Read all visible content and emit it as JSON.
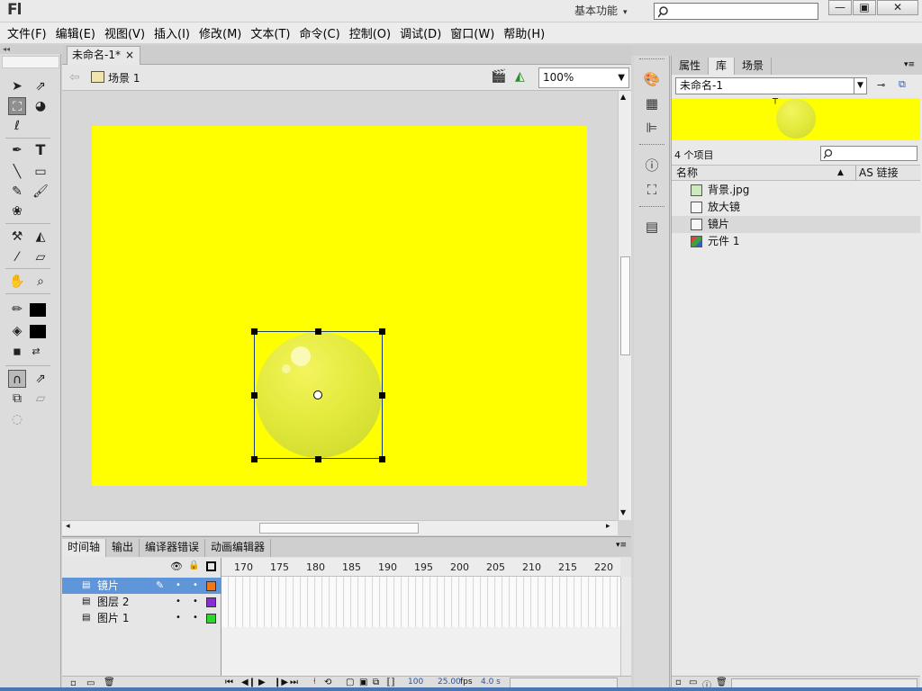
{
  "app": {
    "logo": "Fl",
    "workspace": "基本功能",
    "window_controls": {
      "minimize": "—",
      "maximize": "▣",
      "close": "✕"
    }
  },
  "menu": [
    "文件(F)",
    "编辑(E)",
    "视图(V)",
    "插入(I)",
    "修改(M)",
    "文本(T)",
    "命令(C)",
    "控制(O)",
    "调试(D)",
    "窗口(W)",
    "帮助(H)"
  ],
  "document": {
    "tab_title": "未命名-1*",
    "tab_close": "×",
    "scene": "场景 1",
    "zoom": "100%",
    "stage_color": "#ffff00"
  },
  "timeline": {
    "tabs": [
      "时间轴",
      "输出",
      "编译器错误",
      "动画编辑器"
    ],
    "frame_numbers": [
      "170",
      "175",
      "180",
      "185",
      "190",
      "195",
      "200",
      "205",
      "210",
      "215",
      "220"
    ],
    "layers": [
      {
        "name": "镜片",
        "selected": true,
        "color": "#f07818"
      },
      {
        "name": "图层 2",
        "selected": false,
        "color": "#8a2bd8"
      },
      {
        "name": "图片 1",
        "selected": false,
        "color": "#2ad82a"
      }
    ],
    "status": {
      "frame": "100",
      "fps": "25.00",
      "fps_unit": "fps",
      "time": "4.0 s"
    }
  },
  "library": {
    "tabs": [
      "属性",
      "库",
      "场景"
    ],
    "active_tab": "库",
    "document": "未命名-1",
    "item_count": "4 个项目",
    "columns": {
      "name": "名称",
      "linkage": "AS 链接"
    },
    "items": [
      {
        "name": "背景.jpg",
        "type": "bitmap",
        "selected": false
      },
      {
        "name": "放大镜",
        "type": "graphic",
        "selected": false
      },
      {
        "name": "镜片",
        "type": "graphic",
        "selected": true
      },
      {
        "name": "元件 1",
        "type": "movieclip",
        "selected": false
      }
    ]
  },
  "tools": [
    "selection-tool",
    "subselection-tool",
    "free-transform-tool",
    "3d-rotation-tool",
    "lasso-tool",
    "pen-tool",
    "text-tool",
    "line-tool",
    "rectangle-tool",
    "pencil-tool",
    "brush-tool",
    "deco-tool",
    "bone-tool",
    "paint-bucket-tool",
    "eyedropper-tool",
    "eraser-tool",
    "hand-tool",
    "zoom-tool",
    "stroke-color",
    "fill-color"
  ],
  "colors": {
    "accent": "#5f95d9",
    "stage": "#ffff00",
    "chrome": "#d4d4d4"
  }
}
